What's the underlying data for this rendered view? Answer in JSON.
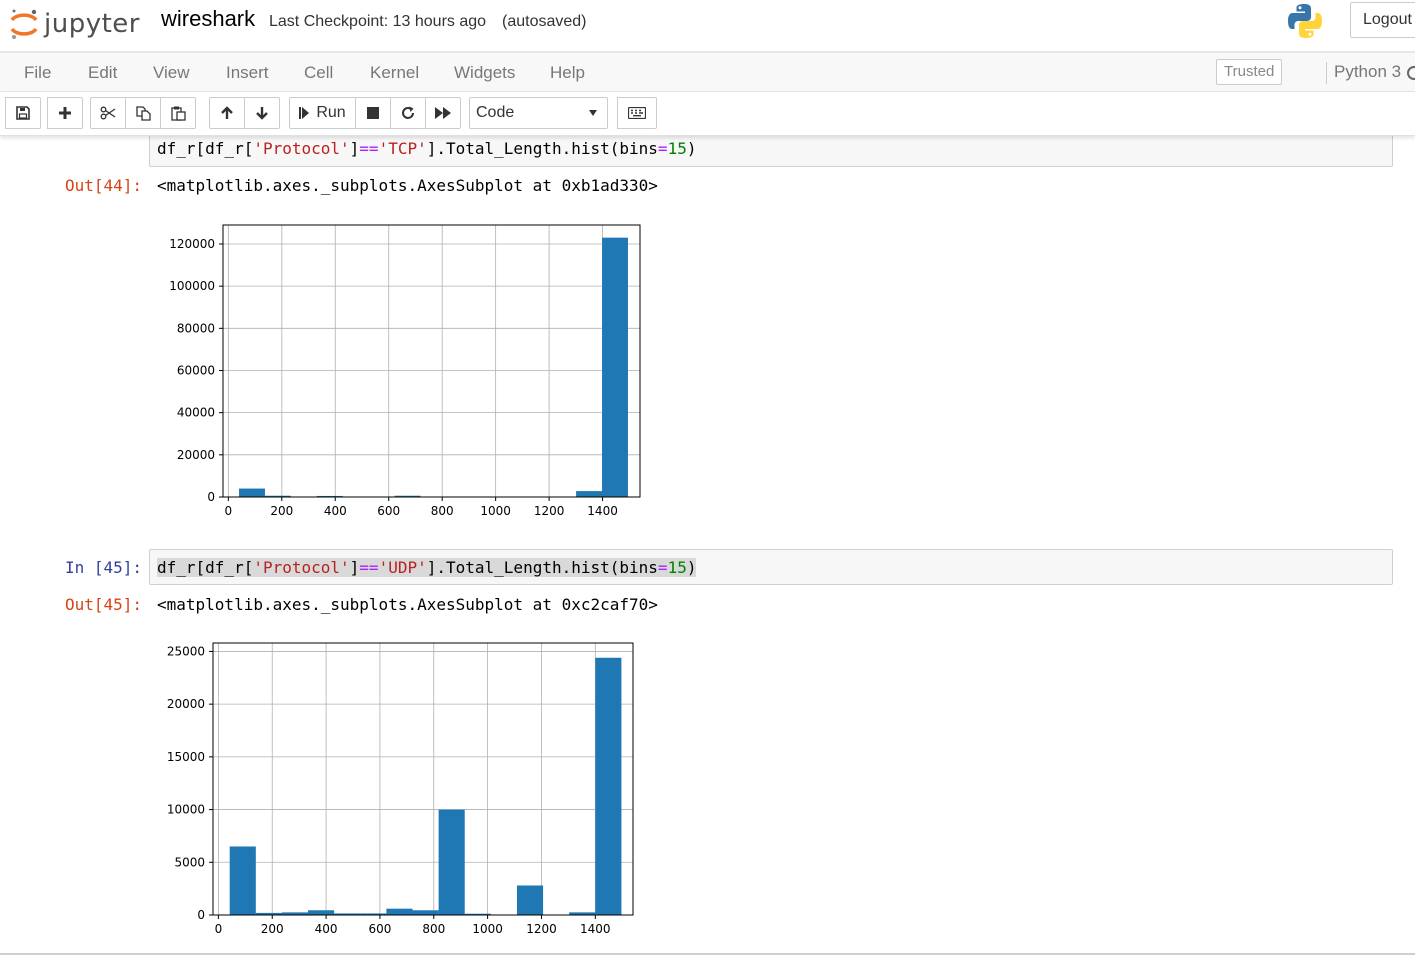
{
  "header": {
    "logo_text": "jupyter",
    "notebook_name": "wireshark",
    "checkpoint": "Last Checkpoint: 13 hours ago",
    "autosave": "(autosaved)",
    "logout_label": "Logout"
  },
  "menubar": {
    "items": [
      "File",
      "Edit",
      "View",
      "Insert",
      "Cell",
      "Kernel",
      "Widgets",
      "Help"
    ],
    "trusted_label": "Trusted",
    "kernel_name": "Python 3"
  },
  "toolbar": {
    "run_label": "Run",
    "cell_type": "Code"
  },
  "cells": [
    {
      "input": {
        "code_parts": [
          "df_r[df_r[",
          "'Protocol'",
          "]",
          "==",
          "'TCP'",
          "].Total_Length.hist(bins",
          "=",
          "15",
          ")"
        ]
      },
      "output": {
        "prompt": "Out[44]:",
        "text": "<matplotlib.axes._subplots.AxesSubplot at 0xb1ad330>"
      }
    },
    {
      "input": {
        "prompt": "In [45]:",
        "code_parts": [
          "df_r[df_r[",
          "'Protocol'",
          "]",
          "==",
          "'UDP'",
          "].Total_Length.hist(bins",
          "=",
          "15",
          ")"
        ]
      },
      "output": {
        "prompt": "Out[45]:",
        "text": "<matplotlib.axes._subplots.AxesSubplot at 0xc2caf70>"
      }
    }
  ],
  "chart_data": [
    {
      "type": "bar",
      "bar_color": "#1f77b4",
      "grid": true,
      "xlim": [
        -20,
        1540
      ],
      "ylim": [
        0,
        129000
      ],
      "xticks": [
        0,
        200,
        400,
        600,
        800,
        1000,
        1200,
        1400
      ],
      "yticks": [
        0,
        20000,
        40000,
        60000,
        80000,
        100000,
        120000
      ],
      "bins": [
        {
          "x0": 40,
          "x1": 137,
          "value": 4000
        },
        {
          "x0": 137,
          "x1": 234,
          "value": 600
        },
        {
          "x0": 234,
          "x1": 331,
          "value": 100
        },
        {
          "x0": 331,
          "x1": 428,
          "value": 500
        },
        {
          "x0": 428,
          "x1": 525,
          "value": 200
        },
        {
          "x0": 525,
          "x1": 622,
          "value": 100
        },
        {
          "x0": 622,
          "x1": 719,
          "value": 600
        },
        {
          "x0": 719,
          "x1": 816,
          "value": 100
        },
        {
          "x0": 816,
          "x1": 913,
          "value": 100
        },
        {
          "x0": 913,
          "x1": 1010,
          "value": 100
        },
        {
          "x0": 1010,
          "x1": 1107,
          "value": 100
        },
        {
          "x0": 1107,
          "x1": 1204,
          "value": 100
        },
        {
          "x0": 1204,
          "x1": 1301,
          "value": 100
        },
        {
          "x0": 1301,
          "x1": 1398,
          "value": 2800
        },
        {
          "x0": 1398,
          "x1": 1495,
          "value": 123000
        }
      ]
    },
    {
      "type": "bar",
      "bar_color": "#1f77b4",
      "grid": true,
      "xlim": [
        -20,
        1540
      ],
      "ylim": [
        0,
        25800
      ],
      "xticks": [
        0,
        200,
        400,
        600,
        800,
        1000,
        1200,
        1400
      ],
      "yticks": [
        0,
        5000,
        10000,
        15000,
        20000,
        25000
      ],
      "bins": [
        {
          "x0": 42,
          "x1": 139,
          "value": 6500
        },
        {
          "x0": 139,
          "x1": 236,
          "value": 200
        },
        {
          "x0": 236,
          "x1": 333,
          "value": 250
        },
        {
          "x0": 333,
          "x1": 430,
          "value": 450
        },
        {
          "x0": 430,
          "x1": 527,
          "value": 150
        },
        {
          "x0": 527,
          "x1": 624,
          "value": 150
        },
        {
          "x0": 624,
          "x1": 721,
          "value": 600
        },
        {
          "x0": 721,
          "x1": 818,
          "value": 450
        },
        {
          "x0": 818,
          "x1": 915,
          "value": 10000
        },
        {
          "x0": 915,
          "x1": 1012,
          "value": 120
        },
        {
          "x0": 1012,
          "x1": 1109,
          "value": 0
        },
        {
          "x0": 1109,
          "x1": 1206,
          "value": 2800
        },
        {
          "x0": 1206,
          "x1": 1303,
          "value": 0
        },
        {
          "x0": 1303,
          "x1": 1400,
          "value": 250
        },
        {
          "x0": 1400,
          "x1": 1497,
          "value": 24400
        }
      ]
    }
  ]
}
